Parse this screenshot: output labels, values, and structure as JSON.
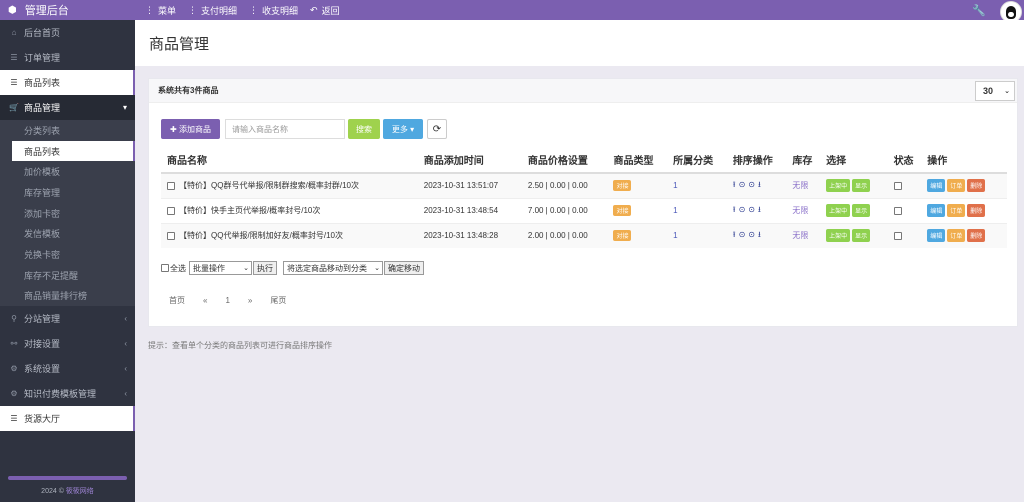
{
  "app": {
    "brand": "管理后台"
  },
  "topnav": {
    "items": [
      {
        "label": "菜单"
      },
      {
        "label": "支付明细"
      },
      {
        "label": "收支明细"
      },
      {
        "label": "返回"
      }
    ]
  },
  "sidebar": {
    "home": "后台首页",
    "orders": "订单管理",
    "goods_list": "商品列表",
    "goods_manage": "商品管理",
    "sub": [
      "分类列表",
      "商品列表",
      "加价模板",
      "库存管理",
      "添加卡密",
      "发信模板",
      "兑换卡密",
      "库存不足提醒",
      "商品销量排行榜"
    ],
    "site_manage": "分站管理",
    "dock": "对接设置",
    "sys": "系统设置",
    "knowledge": "知识付费模板管理",
    "source": "货源大厅",
    "footer_year": "2024 ©",
    "footer_link": "筱筱网络"
  },
  "page": {
    "title": "商品管理"
  },
  "panel": {
    "summary": "系统共有3件商品",
    "page_size": "30"
  },
  "toolbar": {
    "add": "✚ 添加商品",
    "search_placeholder": "请输入商品名称",
    "search": "搜索",
    "more": "更多 ▾"
  },
  "table": {
    "headers": [
      "商品名称",
      "商品添加时间",
      "商品价格设置",
      "商品类型",
      "所属分类",
      "排序操作",
      "库存",
      "选择",
      "状态",
      "操作"
    ],
    "rows": [
      {
        "name": "【特价】QQ群号代举报/限制群搜索/概率封群/10次",
        "time": "2023-10-31 13:51:07",
        "price": "2.50 | 0.00 | 0.00",
        "type": "对接",
        "category": "1",
        "stock": "无限",
        "onsale": "上架中",
        "show": "显示"
      },
      {
        "name": "【特价】快手主页代举报/概率封号/10次",
        "time": "2023-10-31 13:48:54",
        "price": "7.00 | 0.00 | 0.00",
        "type": "对接",
        "category": "1",
        "stock": "无限",
        "onsale": "上架中",
        "show": "显示"
      },
      {
        "name": "【特价】QQ代举报/限制加好友/概率封号/10次",
        "time": "2023-10-31 13:48:28",
        "price": "2.00 | 0.00 | 0.00",
        "type": "对接",
        "category": "1",
        "stock": "无限",
        "onsale": "上架中",
        "show": "显示"
      }
    ],
    "ops": {
      "edit": "编辑",
      "order": "订单",
      "del": "删除"
    }
  },
  "bulk": {
    "select_all": "全选",
    "batch": "批量操作",
    "exec": "执行",
    "move_select": "将选定商品移动到分类",
    "confirm_move": "确定移动"
  },
  "pager": {
    "first": "首页",
    "prev": "«",
    "current": "1",
    "next": "»",
    "last": "尾页"
  },
  "tip": "提示：查看单个分类的商品列表可进行商品排序操作",
  "colors": {
    "accent": "#7b5fb0",
    "sidebar": "#2f3340",
    "green": "#8fd14f",
    "blue": "#4fa8e0",
    "orange": "#f0ad4e",
    "red": "#e0704a"
  }
}
